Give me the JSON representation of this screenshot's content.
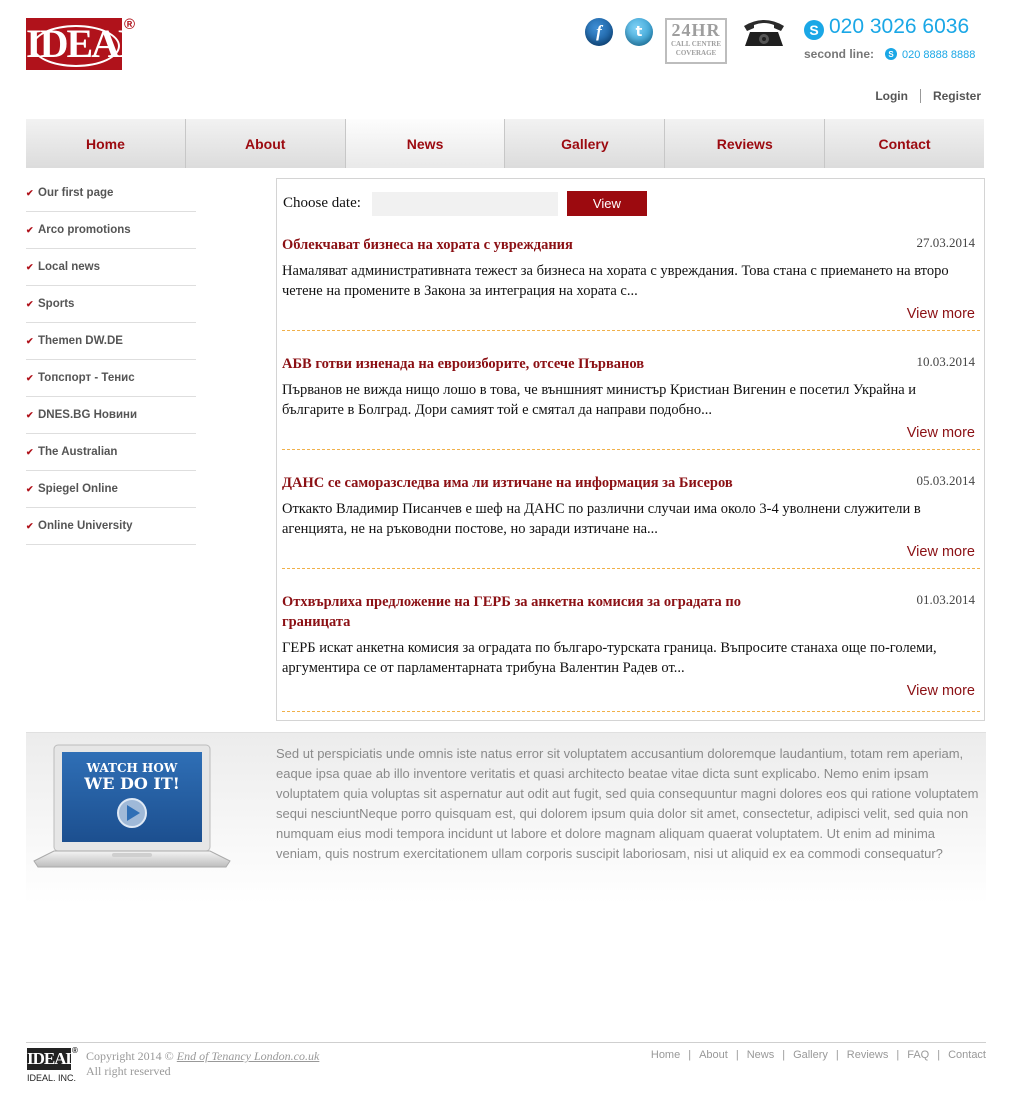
{
  "brand": {
    "logo_text": "IDEAL",
    "registered": "®"
  },
  "header": {
    "badge_big": "24HR",
    "badge_small_1": "CALL CENTRE",
    "badge_small_2": "COVERAGE",
    "skype_glyph": "S",
    "phone_main": "020 3026 6036",
    "second_label": "second line:",
    "second_number": "020 8888 8888",
    "login": "Login",
    "register": "Register",
    "icons": [
      "facebook-icon",
      "twitter-icon",
      "24hr-badge",
      "telephone-icon",
      "skype-icon"
    ]
  },
  "nav": {
    "items": [
      {
        "label": "Home",
        "active": false
      },
      {
        "label": "About",
        "active": false
      },
      {
        "label": "News",
        "active": true
      },
      {
        "label": "Gallery",
        "active": false
      },
      {
        "label": "Reviews",
        "active": false
      },
      {
        "label": "Contact",
        "active": false
      }
    ]
  },
  "sidebar": {
    "items": [
      {
        "label": "Our first page"
      },
      {
        "label": "Arco promotions"
      },
      {
        "label": "Local news"
      },
      {
        "label": "Sports"
      },
      {
        "label": "Themen DW.DE"
      },
      {
        "label": "Топспорт - Тенис"
      },
      {
        "label": "DNES.BG Новини"
      },
      {
        "label": "The Australian"
      },
      {
        "label": "Spiegel Online"
      },
      {
        "label": "Online University"
      }
    ]
  },
  "filter": {
    "label": "Choose date:",
    "value": "",
    "button": "View"
  },
  "news": [
    {
      "title": "Облекчават бизнеса на хората с увреждания",
      "date": "27.03.2014",
      "body": "Намаляват административната тежест за бизнеса на хората с увреждания. Това стана с приемането на второ четене на промените в Закона за интеграция на хората с...",
      "more": "View more"
    },
    {
      "title": "АБВ готви изненада на евроизборите, отсече Първанов",
      "date": "10.03.2014",
      "body": "Първанов не вижда нищо лошо в това, че външният министър Кристиан Вигенин е посетил Украйна и българите в Болград. Дори самият той е смятал да направи подобно...",
      "more": "View more"
    },
    {
      "title": "ДАНС се саморазследва има ли изтичане на информация за Бисеров",
      "date": "05.03.2014",
      "body": "Откакто Владимир Писанчев е шеф на ДАНС по различни случаи има около 3-4 уволнени служители в агенцията, не на ръководни постове, но заради изтичане на...",
      "more": "View more"
    },
    {
      "title": "Отхвърлиха предложение на ГЕРБ за анкетна комисия за оградата по границата",
      "date": "01.03.2014",
      "body": "ГЕРБ искат анкетна комисия за оградата по българо-турската граница. Въпросите станаха още по-големи, аргументира се от парламентарната трибуна Валентин Радев от...",
      "more": "View more"
    }
  ],
  "promo": {
    "video_line1": "WATCH HOW",
    "video_line2": "WE DO IT!",
    "text": "Sed ut perspiciatis unde omnis iste natus error sit voluptatem accusantium doloremque laudantium, totam rem aperiam, eaque ipsa quae ab illo inventore veritatis et quasi architecto beatae vitae dicta sunt explicabo. Nemo enim ipsam voluptatem quia voluptas sit aspernatur aut odit aut fugit, sed quia consequuntur magni dolores eos qui ratione voluptatem sequi nesciuntNeque porro quisquam est, qui dolorem ipsum quia dolor sit amet, consectetur, adipisci velit, sed quia non numquam eius modi tempora incidunt ut labore et dolore magnam aliquam quaerat voluptatem. Ut enim ad minima veniam, quis nostrum exercitationem ullam corporis suscipit laboriosam, nisi ut aliquid ex ea commodi consequatur?"
  },
  "footer": {
    "logo_text": "IDEAL",
    "logo_reg": "®",
    "logo_sub": "IDEAL. INC.",
    "copyright_prefix": "Copyright 2014 ©",
    "copyright_link": "End of Tenancy London.co.uk",
    "rights": "All right reserved",
    "links": [
      "Home",
      "About",
      "News",
      "Gallery",
      "Reviews",
      "FAQ",
      "Contact"
    ]
  },
  "colors": {
    "brand_red": "#9c0a10",
    "skype_blue": "#1aa7e6",
    "dashed_orange": "#f0b04a"
  }
}
